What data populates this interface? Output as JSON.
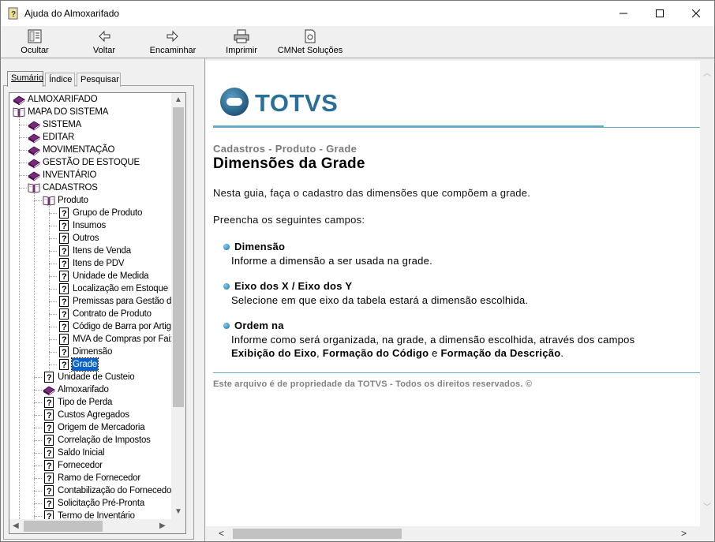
{
  "window": {
    "title": "Ajuda do Almoxarifado",
    "controls": {
      "minimize": "minimize",
      "maximize": "maximize",
      "close": "close"
    }
  },
  "toolbar": {
    "buttons": [
      {
        "label": "Ocultar",
        "icon": "hide-pane-icon"
      },
      {
        "label": "Voltar",
        "icon": "arrow-left-icon"
      },
      {
        "label": "Encaminhar",
        "icon": "arrow-right-icon"
      },
      {
        "label": "Imprimir",
        "icon": "printer-icon"
      },
      {
        "label": "CMNet Soluções",
        "icon": "document-icon"
      }
    ]
  },
  "tabs": [
    {
      "label": "Sumário",
      "active": true
    },
    {
      "label": "Índice",
      "active": false
    },
    {
      "label": "Pesquisar",
      "active": false
    }
  ],
  "tree": [
    {
      "label": "ALMOXARIFADO",
      "icon": "closed-book-icon",
      "level": 0
    },
    {
      "label": "MAPA DO SISTEMA",
      "icon": "open-book-icon",
      "level": 0
    },
    {
      "label": "SISTEMA",
      "icon": "closed-book-icon",
      "level": 1
    },
    {
      "label": "EDITAR",
      "icon": "closed-book-icon",
      "level": 1
    },
    {
      "label": "MOVIMENTAÇÃO",
      "icon": "closed-book-icon",
      "level": 1
    },
    {
      "label": "GESTÃO DE ESTOQUE",
      "icon": "closed-book-icon",
      "level": 1
    },
    {
      "label": "INVENTÁRIO",
      "icon": "closed-book-icon",
      "level": 1
    },
    {
      "label": "CADASTROS",
      "icon": "open-book-icon",
      "level": 1
    },
    {
      "label": "Produto",
      "icon": "open-book-icon",
      "level": 2
    },
    {
      "label": "Grupo de Produto",
      "icon": "help-page-icon",
      "level": 3
    },
    {
      "label": "Insumos",
      "icon": "help-page-icon",
      "level": 3
    },
    {
      "label": "Outros",
      "icon": "help-page-icon",
      "level": 3
    },
    {
      "label": "Itens de Venda",
      "icon": "help-page-icon",
      "level": 3
    },
    {
      "label": "Itens de PDV",
      "icon": "help-page-icon",
      "level": 3
    },
    {
      "label": "Unidade de Medida",
      "icon": "help-page-icon",
      "level": 3
    },
    {
      "label": "Localização em Estoque",
      "icon": "help-page-icon",
      "level": 3
    },
    {
      "label": "Premissas para Gestão de",
      "icon": "help-page-icon",
      "level": 3
    },
    {
      "label": "Contrato de Produto",
      "icon": "help-page-icon",
      "level": 3
    },
    {
      "label": "Código de Barra por Artigo",
      "icon": "help-page-icon",
      "level": 3
    },
    {
      "label": "MVA de Compras por Faixa",
      "icon": "help-page-icon",
      "level": 3
    },
    {
      "label": "Dimensão",
      "icon": "help-page-icon",
      "level": 3
    },
    {
      "label": "Grade",
      "icon": "help-page-icon",
      "level": 3,
      "selected": true
    },
    {
      "label": "Unidade de Custeio",
      "icon": "help-page-icon",
      "level": 2
    },
    {
      "label": "Almoxarifado",
      "icon": "closed-book-icon",
      "level": 2
    },
    {
      "label": "Tipo de Perda",
      "icon": "help-page-icon",
      "level": 2
    },
    {
      "label": "Custos Agregados",
      "icon": "help-page-icon",
      "level": 2
    },
    {
      "label": "Origem de Mercadoria",
      "icon": "help-page-icon",
      "level": 2
    },
    {
      "label": "Correlação de Impostos",
      "icon": "help-page-icon",
      "level": 2
    },
    {
      "label": "Saldo Inicial",
      "icon": "help-page-icon",
      "level": 2
    },
    {
      "label": "Fornecedor",
      "icon": "help-page-icon",
      "level": 2
    },
    {
      "label": "Ramo de Fornecedor",
      "icon": "help-page-icon",
      "level": 2
    },
    {
      "label": "Contabilização do Fornecedor",
      "icon": "help-page-icon",
      "level": 2
    },
    {
      "label": "Solicitação Pré-Pronta",
      "icon": "help-page-icon",
      "level": 2
    },
    {
      "label": "Termo de Inventário",
      "icon": "help-page-icon",
      "level": 2
    }
  ],
  "content": {
    "logo_text": "TOTVS",
    "breadcrumb": "Cadastros - Produto - Grade",
    "title": "Dimensões da Grade",
    "intro": "Nesta guia, faça o cadastro das dimensões que compõem a grade.",
    "instruction": "Preencha os seguintes campos:",
    "fields": [
      {
        "name": "Dimensão",
        "description": "Informe a dimensão a ser usada na grade."
      },
      {
        "name": "Eixo dos X / Eixo dos Y",
        "description": "Selecione em que eixo da tabela estará a dimensão escolhida."
      },
      {
        "name": "Ordem na",
        "description_prefix": "Informe como será organizada, na grade, a dimensão escolhida, através dos campos",
        "ref1": "Exibição do Eixo",
        "sep1": ", ",
        "ref2": "Formação do Código",
        "sep2": " e ",
        "ref3": "Formação da Descrição",
        "end": "."
      }
    ],
    "footer": "Este arquivo é de propriedade da TOTVS - Todos os direitos reservados. ©"
  },
  "colors": {
    "accent": "#2a6f9a",
    "rule": "#67a9c8",
    "selection": "#0a64c8",
    "book": "#7a2a7a"
  }
}
